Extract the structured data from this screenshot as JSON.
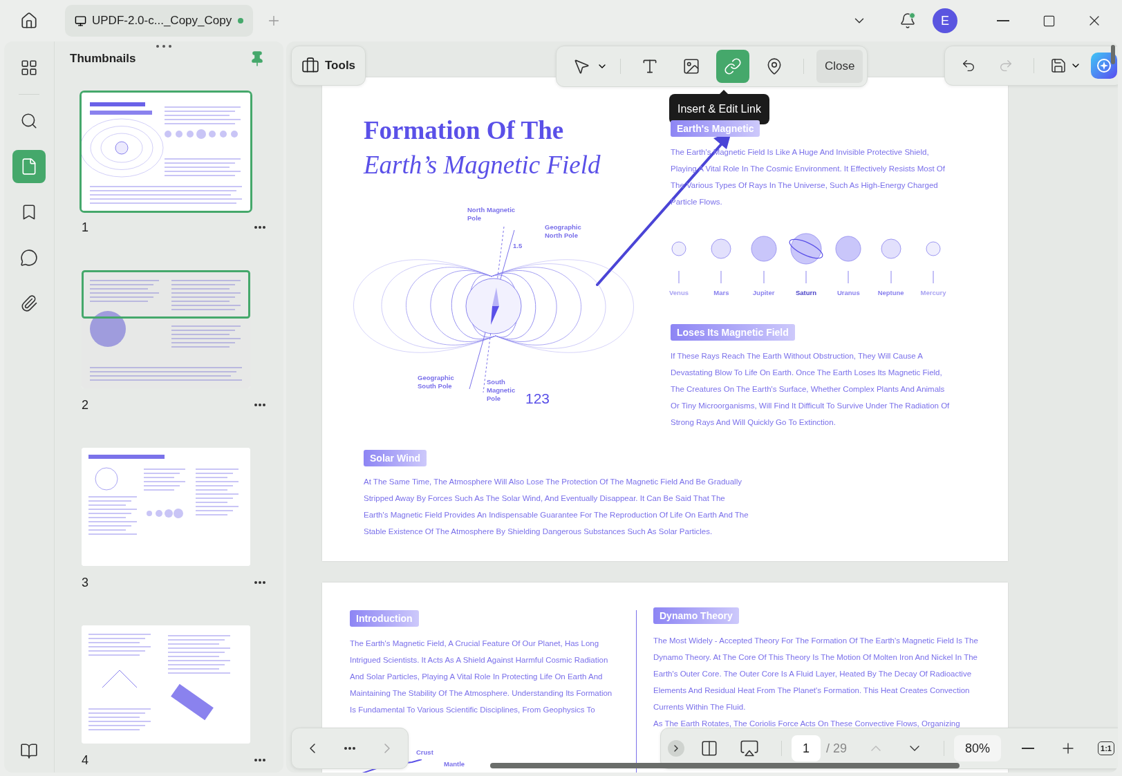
{
  "window": {
    "tab": {
      "title": "UPDF-2.0-c..._Copy_Copy",
      "modified": true
    },
    "notification": true,
    "avatar": "E"
  },
  "rail": [
    {
      "kind": "grid",
      "selected": false
    },
    {
      "kind": "search",
      "selected": false
    },
    {
      "kind": "pages",
      "selected": true
    },
    {
      "kind": "bookmark",
      "selected": false
    },
    {
      "kind": "comment",
      "selected": false
    },
    {
      "kind": "attachment",
      "selected": false
    }
  ],
  "thumbnails": {
    "title": "Thumbnails",
    "pinned": true,
    "pages": [
      {
        "number": "1",
        "selected": true,
        "dimmed": false
      },
      {
        "number": "2",
        "selected": true,
        "dimmed": true
      },
      {
        "number": "3",
        "selected": false,
        "dimmed": false
      },
      {
        "number": "4",
        "selected": false,
        "dimmed": false
      }
    ]
  },
  "toolbar": {
    "label": "Tools",
    "tools": [
      {
        "kind": "pointer",
        "selected": false
      },
      {
        "kind": "text",
        "selected": false
      },
      {
        "kind": "image",
        "selected": false
      },
      {
        "kind": "link",
        "selected": true
      },
      {
        "kind": "pin",
        "selected": false
      }
    ],
    "close": "Close",
    "tooltip": "Insert & Edit Link",
    "undo_disabled": false,
    "redo_disabled": true
  },
  "page_1": {
    "title": "Formation Of The",
    "title_italic": "Earth’s Magnetic Field",
    "diagram_labels": [
      {
        "kind": "north-magnetic",
        "text": "North Magnetic Pole"
      },
      {
        "kind": "geo-north",
        "text": "Geographic North Pole"
      },
      {
        "kind": "angle",
        "text": "1.5"
      },
      {
        "kind": "geo-south",
        "text": "Geographic South Pole"
      },
      {
        "kind": "south-magnetic",
        "text": "South Magnetic Pole"
      },
      {
        "kind": "number",
        "text": "123"
      }
    ],
    "sections": [
      {
        "heading": "Earth's Magnetic",
        "text": "The Earth's Magnetic Field Is Like A Huge And Invisible Protective Shield, Playing A Vital Role In The Cosmic Environment. It Effectively Resists Most Of The Various Types Of Rays In The Universe, Such As High-Energy Charged Particle Flows."
      },
      {
        "heading": "Loses Its Magnetic Field",
        "text": "If These Rays Reach The Earth Without Obstruction, They Will Cause A Devastating Blow To Life On Earth. Once The Earth Loses Its Magnetic Field, The Creatures On The Earth's Surface, Whether Complex Plants And Animals Or Tiny Microorganisms, Will Find It Difficult To Survive Under The Radiation Of Strong Rays And Will Quickly Go To Extinction."
      }
    ],
    "planets": [
      {
        "name": "Venus",
        "kind": "small",
        "bold": false,
        "faded": true
      },
      {
        "name": "Mars",
        "kind": "medium",
        "bold": false,
        "faded": false
      },
      {
        "name": "Jupiter",
        "kind": "large",
        "bold": false,
        "faded": false
      },
      {
        "name": "Saturn",
        "kind": "ringed",
        "bold": true,
        "faded": false
      },
      {
        "name": "Uranus",
        "kind": "large",
        "bold": false,
        "faded": false
      },
      {
        "name": "Neptune",
        "kind": "medium",
        "bold": false,
        "faded": false
      },
      {
        "name": "Mercury",
        "kind": "small",
        "bold": false,
        "faded": true
      }
    ],
    "bottom": {
      "heading": "Solar Wind",
      "text": "At The Same Time, The Atmosphere Will Also Lose The Protection Of The Magnetic Field And Be Gradually Stripped Away By Forces Such As The Solar Wind, And Eventually Disappear. It Can Be Said That The Earth's Magnetic Field Provides An Indispensable Guarantee For The Reproduction Of Life On Earth And The Stable Existence Of The Atmosphere By Shielding Dangerous Substances Such As Solar Particles."
    }
  },
  "page_2": {
    "left": {
      "heading": "Introduction",
      "text": "The Earth's Magnetic Field, A Crucial Feature Of Our Planet, Has Long Intrigued Scientists. It Acts As A Shield Against Harmful Cosmic Radiation And Solar Particles, Playing A Vital Role In Protecting Life On Earth And Maintaining The Stability Of The Atmosphere. Understanding Its Formation Is Fundamental To Various Scientific Disciplines, From Geophysics To"
    },
    "diagram_labels": [
      "Crust",
      "Mantle"
    ],
    "right": {
      "heading": "Dynamo Theory",
      "text": "The Most Widely - Accepted Theory For The Formation Of The Earth's Magnetic Field Is The Dynamo Theory. At The Core Of This Theory Is The Motion Of Molten Iron And Nickel In The Earth's Outer Core. The Outer Core Is A Fluid Layer, Heated By The Decay Of Radioactive Elements And Residual Heat From The Planet's Formation. This Heat Creates Convection Currents Within The Fluid.",
      "more": "As The Earth Rotates, The Coriolis Force Acts On These Convective Flows, Organizing"
    }
  },
  "navigation": {
    "prev_disabled": false,
    "next_disabled": true,
    "page": "1",
    "total": "/ 29",
    "up_disabled": true,
    "down_disabled": false,
    "zoom": "80%",
    "fit": "1:1"
  }
}
